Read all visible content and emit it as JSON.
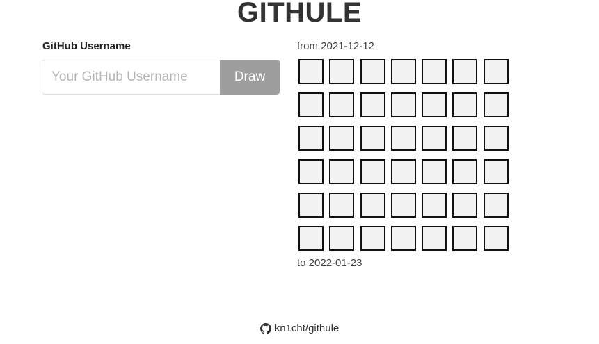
{
  "header": {
    "title": "GITHULE"
  },
  "form": {
    "label": "GitHub Username",
    "input_value": "",
    "input_placeholder": "Your GitHub Username",
    "button_label": "Draw"
  },
  "calendar": {
    "from_text": "from 2021-12-12",
    "to_text": "to 2022-01-23",
    "rows": 6,
    "columns": 7,
    "cell_fill": "#f2f2f2",
    "cell_border": "#111111"
  },
  "footer": {
    "icon": "github-icon",
    "repo_text": "kn1cht/githule"
  },
  "colors": {
    "button_bg": "#9e9e9e",
    "text": "#333333"
  }
}
